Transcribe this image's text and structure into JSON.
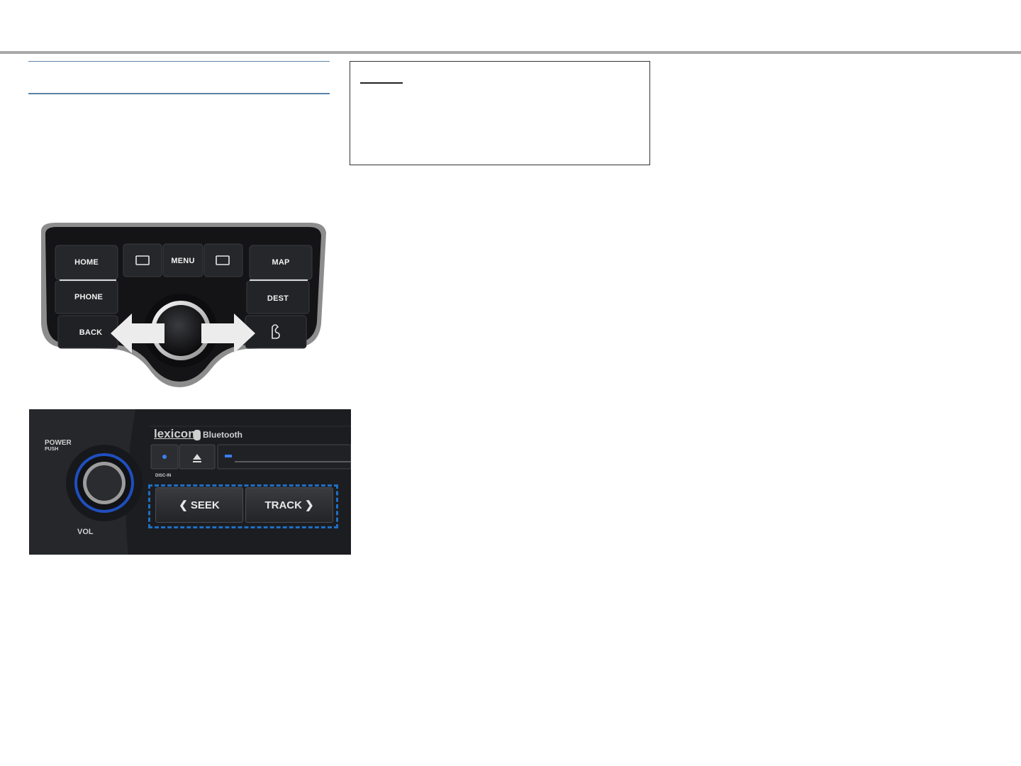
{
  "controller": {
    "buttons": {
      "home": "HOME",
      "phone": "PHONE",
      "back": "BACK",
      "menu": "MENU",
      "map": "MAP",
      "dest": "DEST"
    },
    "icons": [
      "screen-left-icon",
      "screen-right-icon",
      "favorite-icon"
    ],
    "arrow_color": "#ececec"
  },
  "headunit": {
    "brand": "lexicon",
    "bluetooth": "Bluetooth",
    "power": "POWER",
    "push": "PUSH",
    "vol": "VOL",
    "disc_in": "DISC-IN",
    "seek": "SEEK",
    "track": "TRACK",
    "highlight_color": "#1e6fc4",
    "knob_ring_color": "#2f6fe0"
  }
}
